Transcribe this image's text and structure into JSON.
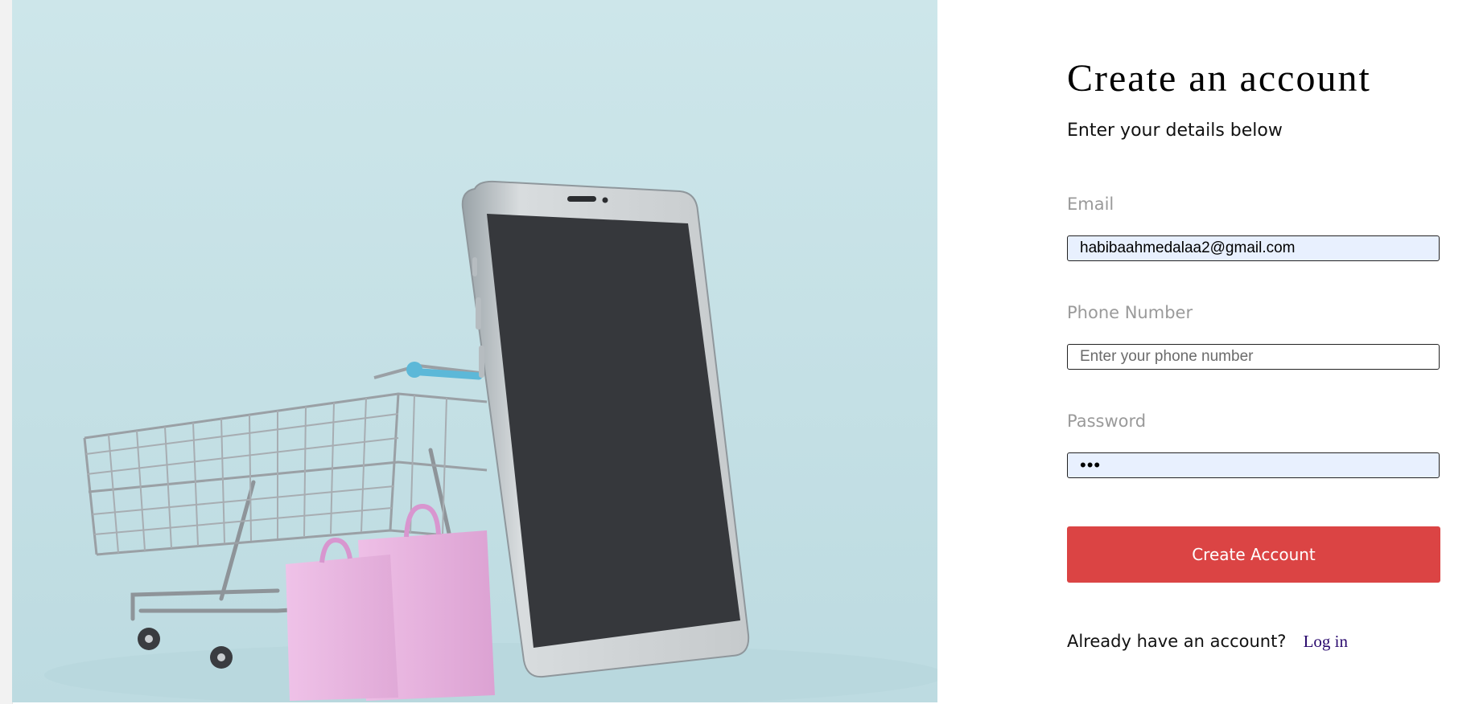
{
  "hero": {
    "alt": "Shopping cart with smartphone and pink shopping bags",
    "colors": {
      "background": "#c9e4e9",
      "screen": "#36383c",
      "phone_frame": "#c9cdd0",
      "bags": "#e8b7e0",
      "cart_metal": "#8e9499",
      "cart_handle": "#5cb8d8"
    }
  },
  "form": {
    "title": "Create an account",
    "subtitle": "Enter your details below",
    "email": {
      "label": "Email",
      "value": "habibaahmedalaa2@gmail.com",
      "placeholder": ""
    },
    "phone": {
      "label": "Phone Number",
      "value": "",
      "placeholder": "Enter your phone number"
    },
    "password": {
      "label": "Password",
      "value": "•••",
      "placeholder": ""
    },
    "submit_label": "Create Account",
    "login_prompt": "Already have an account?",
    "login_link": "Log in"
  },
  "colors": {
    "accent": "#db4444",
    "autofill_bg": "#e8f0fe",
    "label_gray": "#9a9a9a",
    "link": "#2a0a6e"
  }
}
